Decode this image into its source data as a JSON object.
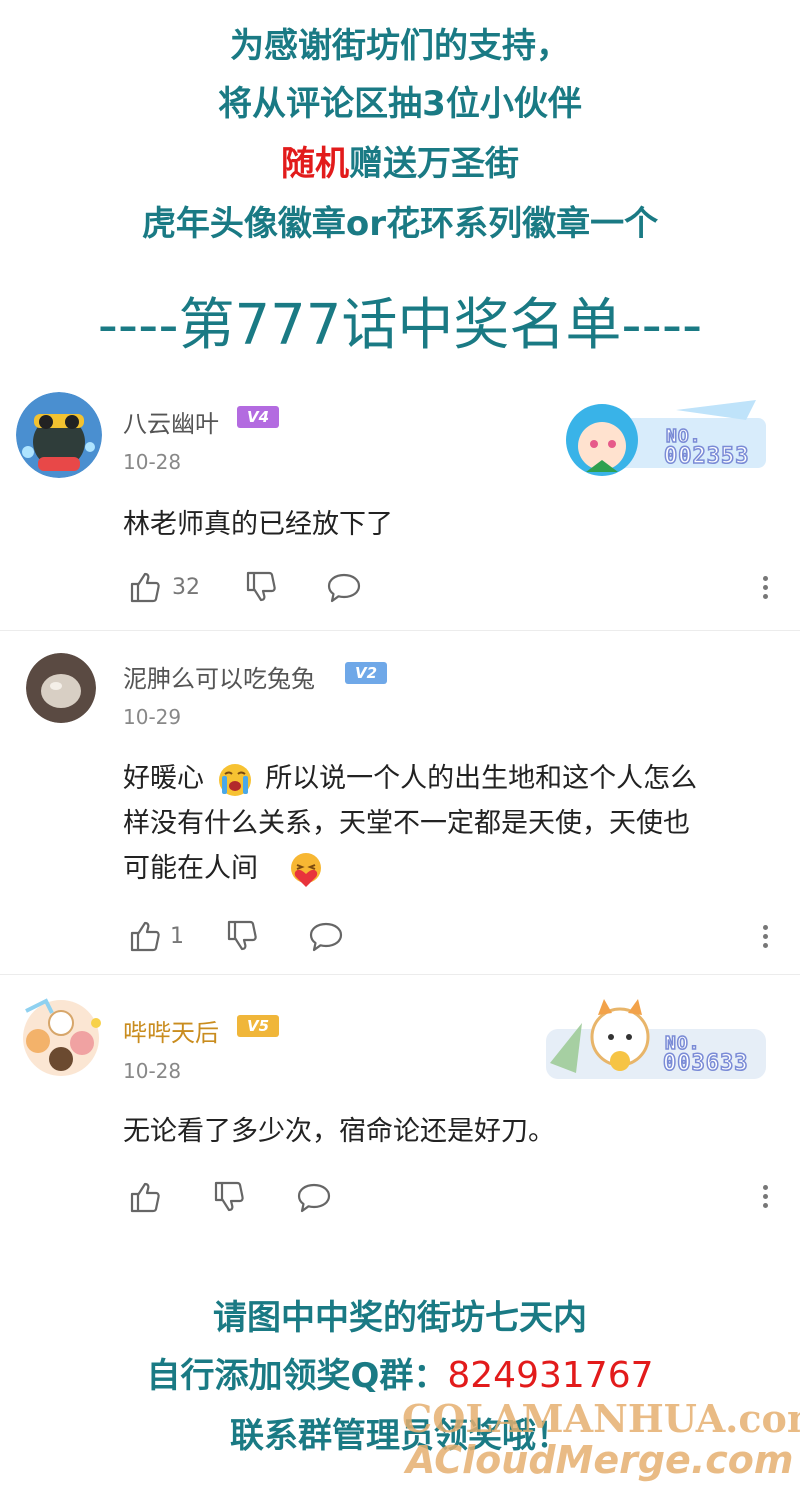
{
  "header": {
    "line1": "为感谢街坊们的支持，",
    "line2": "将从评论区抽3位小伙伴",
    "line3_red": "随机",
    "line3_rest": "赠送万圣街",
    "line4": "虎年头像徽章or花环系列徽章一个",
    "title": "----第777话中奖名单----"
  },
  "comments": [
    {
      "username": "八云幽叶",
      "level": "V4",
      "date": "10-28",
      "text": "林老师真的已经放下了",
      "likes": "32",
      "badge_no": "NO.",
      "badge_num": "002353"
    },
    {
      "username": "泥胂么可以吃兔兔",
      "level": "V2",
      "date": "10-29",
      "text_a": "好暖心",
      "text_b": "所以说一个人的出生地和这个人怎么",
      "text_c": "样没有什么关系，天堂不一定都是天使，天使也",
      "text_d": "可能在人间",
      "likes": "1"
    },
    {
      "username": "哔哔天后",
      "level": "V5",
      "date": "10-28",
      "text": "无论看了多少次，宿命论还是好刀。",
      "likes": "",
      "badge_no": "NO.",
      "badge_num": "003633"
    }
  ],
  "footer": {
    "line1": "请图中中奖的街坊七天内",
    "line2_prefix": "自行添加领奖Q群：",
    "line2_number": "824931767",
    "line3": "联系群管理员领奖哦！",
    "watermark1": "COLAMANHUA.com",
    "watermark2": "ACloudMerge.com"
  },
  "colors": {
    "teal": "#1a7a84",
    "red": "#e21b1b",
    "v4": "#b36be0",
    "v2": "#6fa8e8",
    "v5": "#f0b63a"
  },
  "icons": [
    "thumb-up-icon",
    "thumb-down-icon",
    "comment-bubble-icon",
    "more-vertical-icon",
    "crying-emoji-icon",
    "heart-hug-emoji-icon"
  ]
}
